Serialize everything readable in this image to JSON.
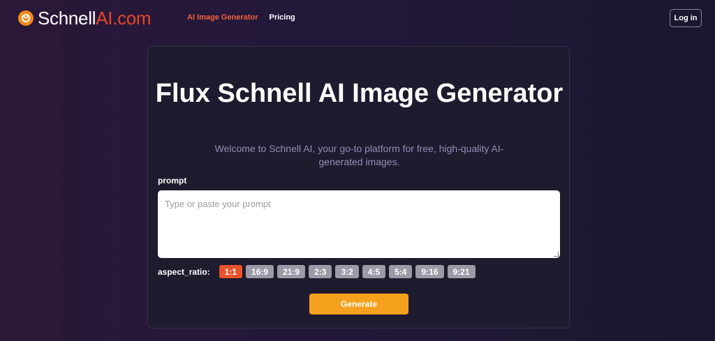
{
  "header": {
    "logo": {
      "icon": "orange-circle-logo-icon",
      "text_white": "Schnell",
      "text_accent": "AI.com",
      "accent_color": "#e8452a"
    },
    "nav": [
      {
        "label": "AI Image Generator",
        "active": true
      },
      {
        "label": "Pricing",
        "active": false
      }
    ],
    "login_label": "Log in"
  },
  "main": {
    "title": "Flux Schnell AI Image Generator",
    "subtitle": "Welcome to Schnell AI, your go-to platform for free, high-quality AI-generated images.",
    "prompt": {
      "label": "prompt",
      "placeholder": "Type or paste your prompt",
      "value": ""
    },
    "aspect_ratio": {
      "label": "aspect_ratio:",
      "options": [
        "1:1",
        "16:9",
        "21:9",
        "2:3",
        "3:2",
        "4:5",
        "5:4",
        "9:16",
        "9:21"
      ],
      "selected": "1:1"
    },
    "generate_label": "Generate"
  },
  "colors": {
    "accent": "#e8522a",
    "generate_button": "#f6a11e",
    "card_bg": "#1e1b2e"
  }
}
